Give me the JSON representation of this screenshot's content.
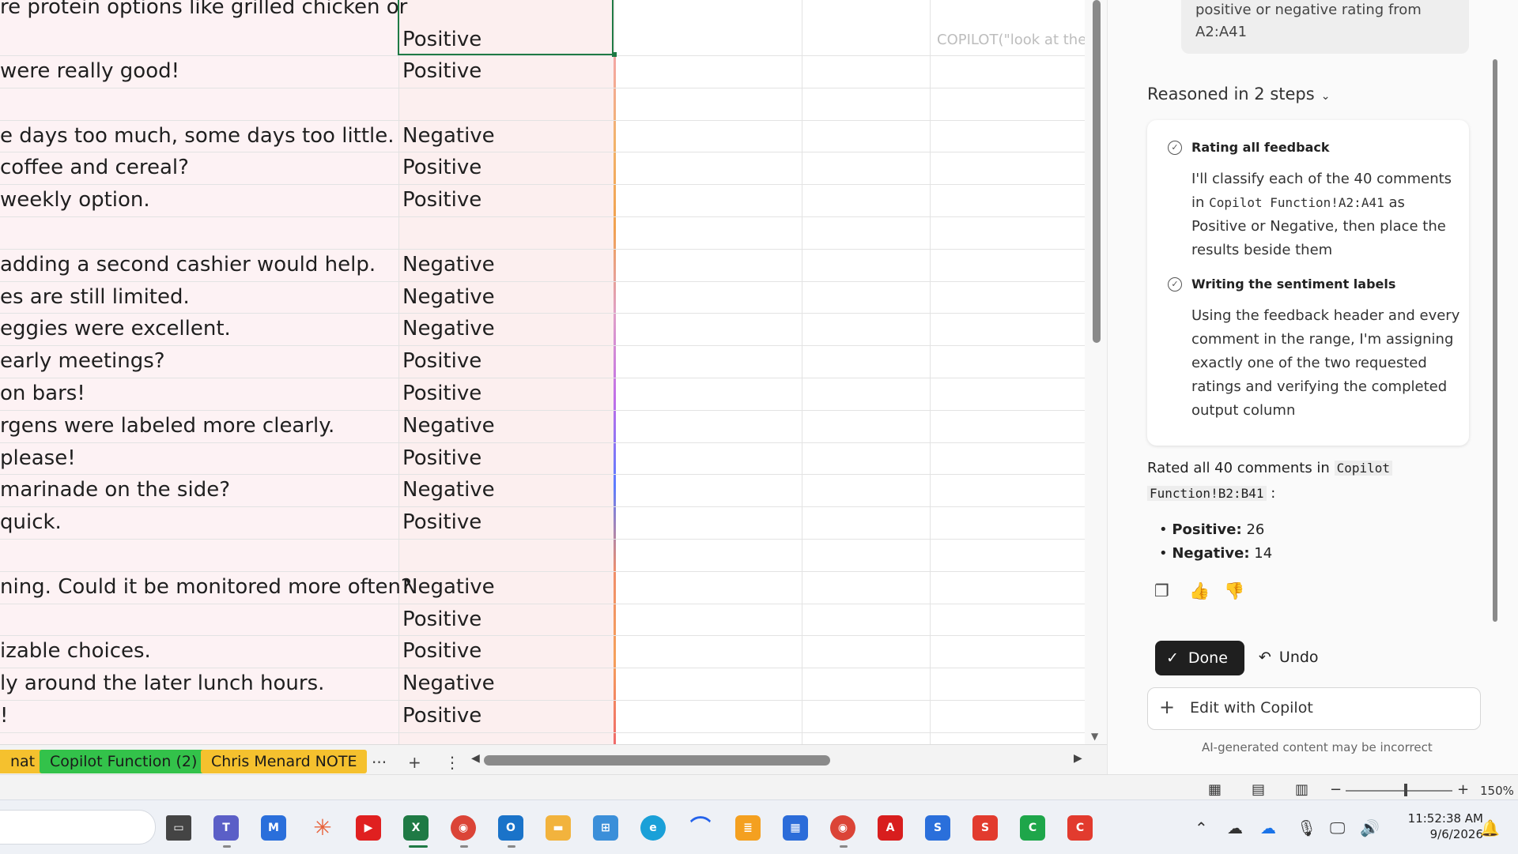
{
  "sheet": {
    "rows": [
      {
        "a": "re protein options like grilled chicken or",
        "b": "Positive"
      },
      {
        "a": "were really good!",
        "b": "Positive"
      },
      {
        "a": "",
        "b": ""
      },
      {
        "a": "e days too much, some days too little.",
        "b": "Negative"
      },
      {
        "a": "coffee and cereal?",
        "b": "Positive"
      },
      {
        "a": "weekly option.",
        "b": "Positive"
      },
      {
        "a": "",
        "b": ""
      },
      {
        "a": "adding a second cashier would help.",
        "b": "Negative"
      },
      {
        "a": "es are still limited.",
        "b": "Negative"
      },
      {
        "a": "eggies were excellent.",
        "b": "Negative"
      },
      {
        "a": " early meetings?",
        "b": "Positive"
      },
      {
        "a": "on bars!",
        "b": "Positive"
      },
      {
        "a": "rgens were labeled more clearly.",
        "b": "Negative"
      },
      {
        "a": "please!",
        "b": "Positive"
      },
      {
        "a": "marinade on the side?",
        "b": "Negative"
      },
      {
        "a": " quick.",
        "b": "Positive"
      },
      {
        "a": "",
        "b": ""
      },
      {
        "a": "ning. Could it be monitored more often?",
        "b": "Negative"
      },
      {
        "a": "",
        "b": "Positive"
      },
      {
        "a": "izable choices.",
        "b": "Positive"
      },
      {
        "a": "ly around the later lunch hours.",
        "b": "Negative"
      },
      {
        "a": "!",
        "b": "Positive"
      }
    ],
    "formula_preview": "COPILOT(\"look at the"
  },
  "tabs": {
    "partial": "nat",
    "items": [
      "Copilot Function (2)",
      "Chris Menard NOTE"
    ],
    "more": "···",
    "add": "+",
    "options": "⋮"
  },
  "copilot": {
    "prompt_line1": "positive or negative rating from",
    "prompt_line2": "A2:A41",
    "reasoned": "Reasoned in 2 steps",
    "step1_title": "Rating all feedback",
    "step1_line1": "I'll classify each of the 40 comments",
    "step1_in": "in",
    "step1_range": "Copilot Function!A2:A41",
    "step1_as": "as",
    "step1_line3": "Positive or Negative, then place the",
    "step1_line4": "results beside them",
    "step2_title": "Writing the sentiment labels",
    "step2_line1": "Using the feedback header and every",
    "step2_line2": "comment in the range, I'm assigning",
    "step2_line3": "exactly one of the two requested",
    "step2_line4": "ratings and verifying the completed",
    "step2_line5": "output column",
    "summary_text": "Rated all 40 comments in",
    "summary_range1": "Copilot",
    "summary_range2": "Function!B2:B41",
    "summary_colon": ":",
    "positive_label": "Positive:",
    "positive_count": "26",
    "negative_label": "Negative:",
    "negative_count": "14",
    "done": "Done",
    "undo": "Undo",
    "edit": "Edit with Copilot",
    "disclaimer": "AI-generated content may be incorrect"
  },
  "status": {
    "zoom_minus": "−",
    "zoom_plus": "+",
    "zoom": "150%"
  },
  "taskbar": {
    "time": "11:52:38 AM",
    "date": "9/6/2026"
  },
  "colors": {
    "tab_green": "#33c24a",
    "tab_yellow": "#f5c12e",
    "selection": "#1f7a45"
  }
}
